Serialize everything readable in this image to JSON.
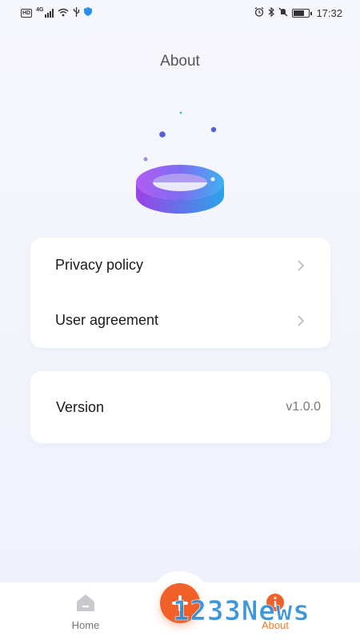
{
  "status_bar": {
    "hd": "HD",
    "network": "4G",
    "time": "17:32",
    "icons": [
      "wifi-icon",
      "usb-icon",
      "shield-icon",
      "alarm-icon",
      "bluetooth-icon",
      "mute-icon",
      "battery-icon"
    ]
  },
  "header": {
    "title": "About"
  },
  "links": [
    {
      "label": "Privacy policy"
    },
    {
      "label": "User agreement"
    }
  ],
  "version": {
    "label": "Version",
    "value": "v1.0.0"
  },
  "bottom_nav": {
    "home_label": "Home",
    "about_label": "About",
    "active": "About",
    "accent": "#f07a2a"
  },
  "watermark": {
    "text": "1233News"
  }
}
